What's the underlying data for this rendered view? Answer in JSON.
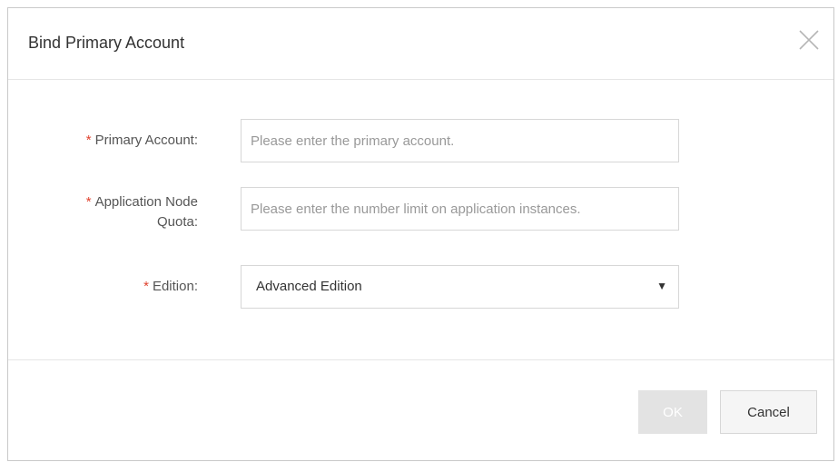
{
  "dialog": {
    "title": "Bind Primary Account",
    "close_icon": "close-icon"
  },
  "form": {
    "primary_account": {
      "required_mark": "*",
      "label": "Primary Account:",
      "placeholder": "Please enter the primary account.",
      "value": ""
    },
    "app_node_quota": {
      "required_mark": "*",
      "label_line1": "Application Node",
      "label_line2": "Quota:",
      "placeholder": "Please enter the number limit on application instances.",
      "value": ""
    },
    "edition": {
      "required_mark": "*",
      "label": "Edition:",
      "selected": "Advanced Edition",
      "arrow": "▼"
    }
  },
  "footer": {
    "ok_label": "OK",
    "cancel_label": "Cancel"
  },
  "colors": {
    "required": "#e0432f",
    "ok_disabled_bg": "#e3e3e3",
    "border": "#d7d7d7"
  }
}
